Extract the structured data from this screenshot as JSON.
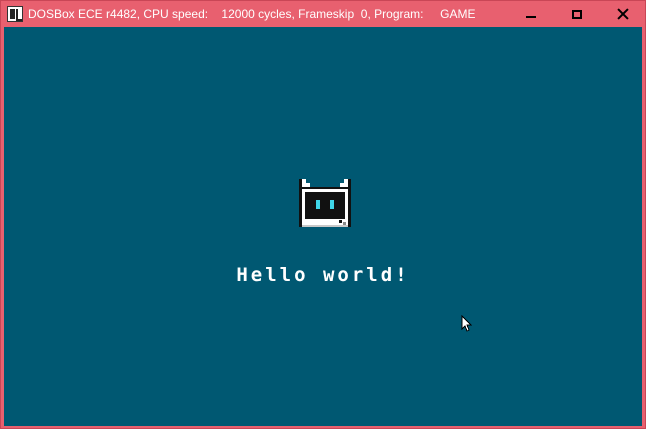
{
  "window": {
    "title": "DOSBox ECE r4482, CPU speed:    12000 cycles, Frameskip  0, Program:     GAME",
    "app_icon": "dosbox-icon",
    "controls": {
      "minimize": "minimize-icon",
      "maximize": "maximize-icon",
      "close": "close-icon"
    }
  },
  "screen": {
    "background": "#005872",
    "mascot_icon": "robot-cat-icon",
    "message": "Hello world!",
    "cursor_icon": "mouse-pointer-icon"
  },
  "colors": {
    "titlebar": "#e8606f",
    "screen": "#005872",
    "text": "#ffffff",
    "mascot_eyes": "#3fd6e8"
  }
}
